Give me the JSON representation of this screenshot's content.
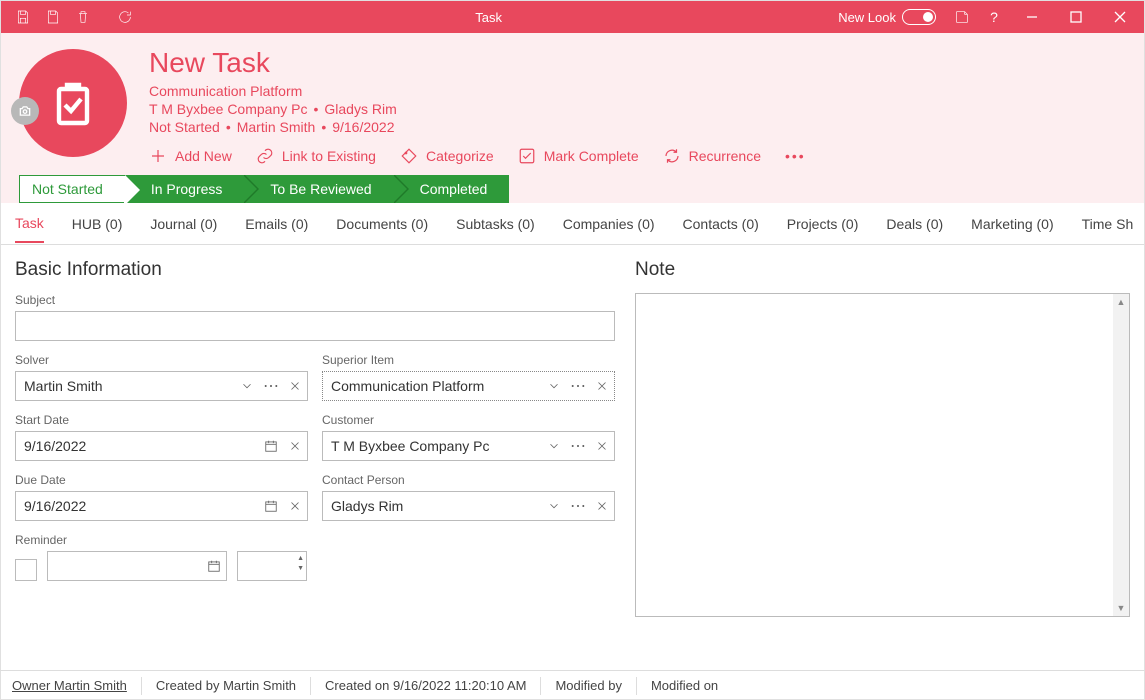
{
  "window": {
    "title": "Task",
    "newLookLabel": "New Look"
  },
  "header": {
    "title": "New Task",
    "line1": "Communication Platform",
    "company": "T M Byxbee Company Pc",
    "contact": "Gladys Rim",
    "status": "Not Started",
    "owner": "Martin Smith",
    "date": "9/16/2022"
  },
  "actions": {
    "addNew": "Add New",
    "linkExisting": "Link to Existing",
    "categorize": "Categorize",
    "markComplete": "Mark Complete",
    "recurrence": "Recurrence"
  },
  "stages": [
    "Not Started",
    "In Progress",
    "To Be Reviewed",
    "Completed"
  ],
  "tabs": [
    "Task",
    "HUB (0)",
    "Journal (0)",
    "Emails (0)",
    "Documents (0)",
    "Subtasks (0)",
    "Companies (0)",
    "Contacts (0)",
    "Projects (0)",
    "Deals (0)",
    "Marketing (0)",
    "Time Sh"
  ],
  "form": {
    "basicInfo": "Basic Information",
    "noteTitle": "Note",
    "subjectLabel": "Subject",
    "subjectValue": "",
    "solverLabel": "Solver",
    "solverValue": "Martin Smith",
    "superiorLabel": "Superior Item",
    "superiorValue": "Communication Platform",
    "startDateLabel": "Start Date",
    "startDateValue": "9/16/2022",
    "customerLabel": "Customer",
    "customerValue": "T M Byxbee Company Pc",
    "dueDateLabel": "Due Date",
    "dueDateValue": "9/16/2022",
    "contactLabel": "Contact Person",
    "contactValue": "Gladys Rim",
    "reminderLabel": "Reminder"
  },
  "status": {
    "owner": "Owner Martin Smith",
    "createdBy": "Created by Martin Smith",
    "createdOn": "Created on 9/16/2022 11:20:10 AM",
    "modifiedBy": "Modified by",
    "modifiedOn": "Modified on"
  }
}
